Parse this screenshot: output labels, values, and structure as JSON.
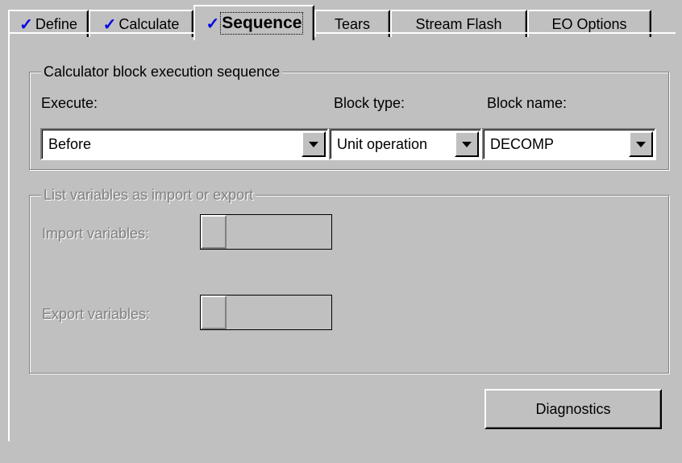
{
  "tabs": [
    {
      "label": "Define",
      "checked": true,
      "active": false
    },
    {
      "label": "Calculate",
      "checked": true,
      "active": false
    },
    {
      "label": "Sequence",
      "checked": true,
      "active": true
    },
    {
      "label": "Tears",
      "checked": false,
      "active": false
    },
    {
      "label": "Stream Flash",
      "checked": false,
      "active": false
    },
    {
      "label": "EO Options",
      "checked": false,
      "active": false
    }
  ],
  "check_glyph": "✓",
  "sequence_group": {
    "title": "Calculator block execution sequence",
    "execute_label": "Execute:",
    "execute_value": "Before",
    "block_type_label": "Block type:",
    "block_type_value": "Unit operation",
    "block_name_label": "Block name:",
    "block_name_value": "DECOMP"
  },
  "variables_group": {
    "title": "List variables as import or export",
    "import_label": "Import variables:",
    "export_label": "Export variables:"
  },
  "diagnostics_label": "Diagnostics",
  "colors": {
    "face": "#c0c0c0",
    "check": "#0000e6",
    "disabled_text": "#808080"
  }
}
